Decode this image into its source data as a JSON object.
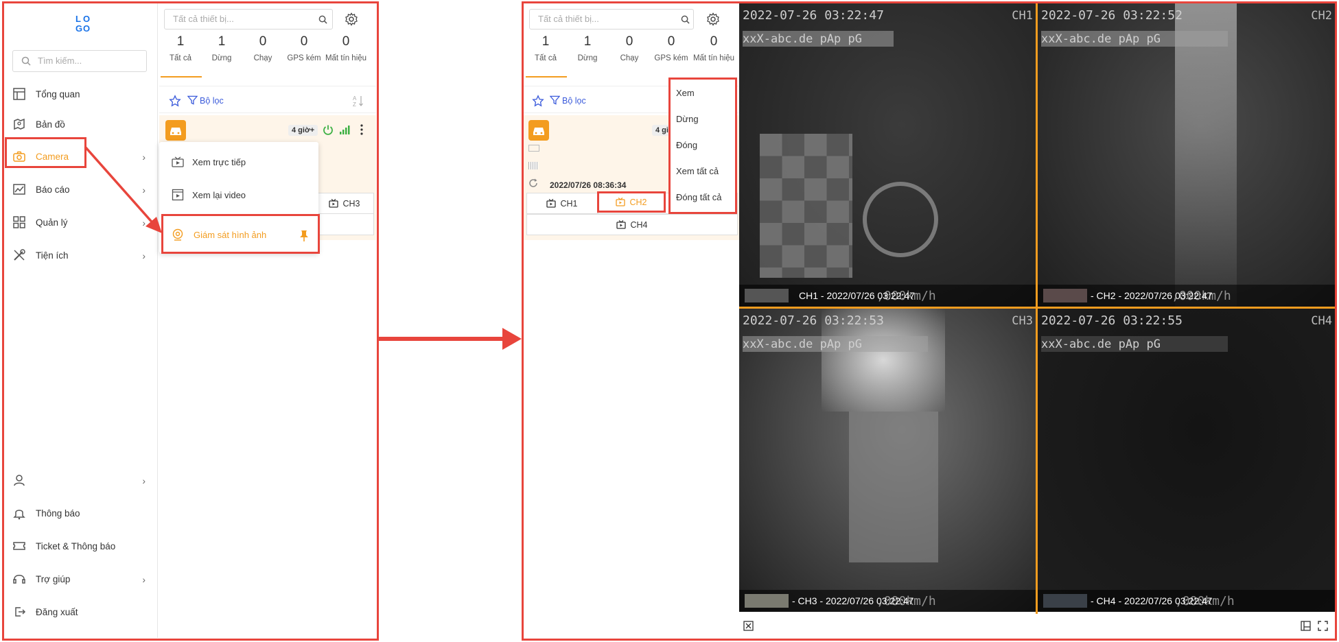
{
  "left": {
    "logo": "LOGO",
    "search_placeholder": "Tìm kiếm...",
    "nav_top": [
      {
        "label": "Tổng quan",
        "icon": "layout-icon"
      },
      {
        "label": "Bản đồ",
        "icon": "map-icon"
      },
      {
        "label": "Camera",
        "icon": "camera-icon"
      },
      {
        "label": "Báo cáo",
        "icon": "chart-icon"
      },
      {
        "label": "Quản lý",
        "icon": "grid-icon"
      },
      {
        "label": "Tiện ích",
        "icon": "tools-icon"
      }
    ],
    "nav_bottom": [
      {
        "label": "",
        "icon": "user-icon"
      },
      {
        "label": "Thông báo",
        "icon": "bell-icon"
      },
      {
        "label": "Ticket & Thông báo",
        "icon": "ticket-icon"
      },
      {
        "label": "Trợ giúp",
        "icon": "headset-icon"
      },
      {
        "label": "Đăng xuất",
        "icon": "logout-icon"
      }
    ],
    "camera_submenu": [
      "Xem trực tiếp",
      "Xem lại video",
      "Giám sát hình ảnh"
    ],
    "device_search_placeholder": "Tất cả thiết bị...",
    "stats": [
      {
        "num": "1",
        "label": "Tất cả"
      },
      {
        "num": "1",
        "label": "Dừng"
      },
      {
        "num": "0",
        "label": "Chạy"
      },
      {
        "num": "0",
        "label": "GPS kém"
      },
      {
        "num": "0",
        "label": "Mất tín hiệu"
      }
    ],
    "filter_label": "Bộ lọc",
    "time_badge": "4 giờ+",
    "channel": "CH3"
  },
  "right": {
    "device_search_placeholder": "Tất cả thiết bị...",
    "stats": [
      {
        "num": "1",
        "label": "Tất cả"
      },
      {
        "num": "1",
        "label": "Dừng"
      },
      {
        "num": "0",
        "label": "Chạy"
      },
      {
        "num": "0",
        "label": "GPS kém"
      },
      {
        "num": "0",
        "label": "Mất tín hiệu"
      }
    ],
    "filter_label": "Bộ lọc",
    "time_badge_partial": "4 gi",
    "timestamp": "2022/07/26 08:36:34",
    "channels": [
      "CH1",
      "CH2",
      "CH4"
    ],
    "context_menu": [
      "Xem",
      "Dừng",
      "Đóng",
      "Xem tất cả",
      "Đóng tất cả"
    ],
    "cameras": [
      {
        "ts": "2022-07-26 03:22:47",
        "ch": "CH1",
        "wm": "xxX-abc.de  pAp pG",
        "caption": "CH1 - 2022/07/26 03:22:47",
        "speed": ",000km/h",
        "shade": "#3b3b3b"
      },
      {
        "ts": "2022-07-26 03:22:52",
        "ch": "CH2",
        "wm": "xxX-abc.de  pAp pG",
        "caption": "- CH2 - 2022/07/26 03:22:47",
        "speed": ",000km/h",
        "shade": "#4a4a4a"
      },
      {
        "ts": "2022-07-26 03:22:53",
        "ch": "CH3",
        "wm": "xxX-abc.de  pAp pG",
        "caption": "- CH3 - 2022/07/26 03:22:47",
        "speed": ",000km/h",
        "shade": "#6f6f6f"
      },
      {
        "ts": "2022-07-26 03:22:55",
        "ch": "CH4",
        "wm": "xxX-abc.de  pAp pG",
        "caption": "- CH4 - 2022/07/26 03:22:47",
        "speed": ",000km/h",
        "shade": "#141414"
      }
    ]
  },
  "colors": {
    "accent": "#f39c1f",
    "annotation": "#e8453c",
    "link": "#3b5bdb",
    "brand": "#1a73e8"
  }
}
